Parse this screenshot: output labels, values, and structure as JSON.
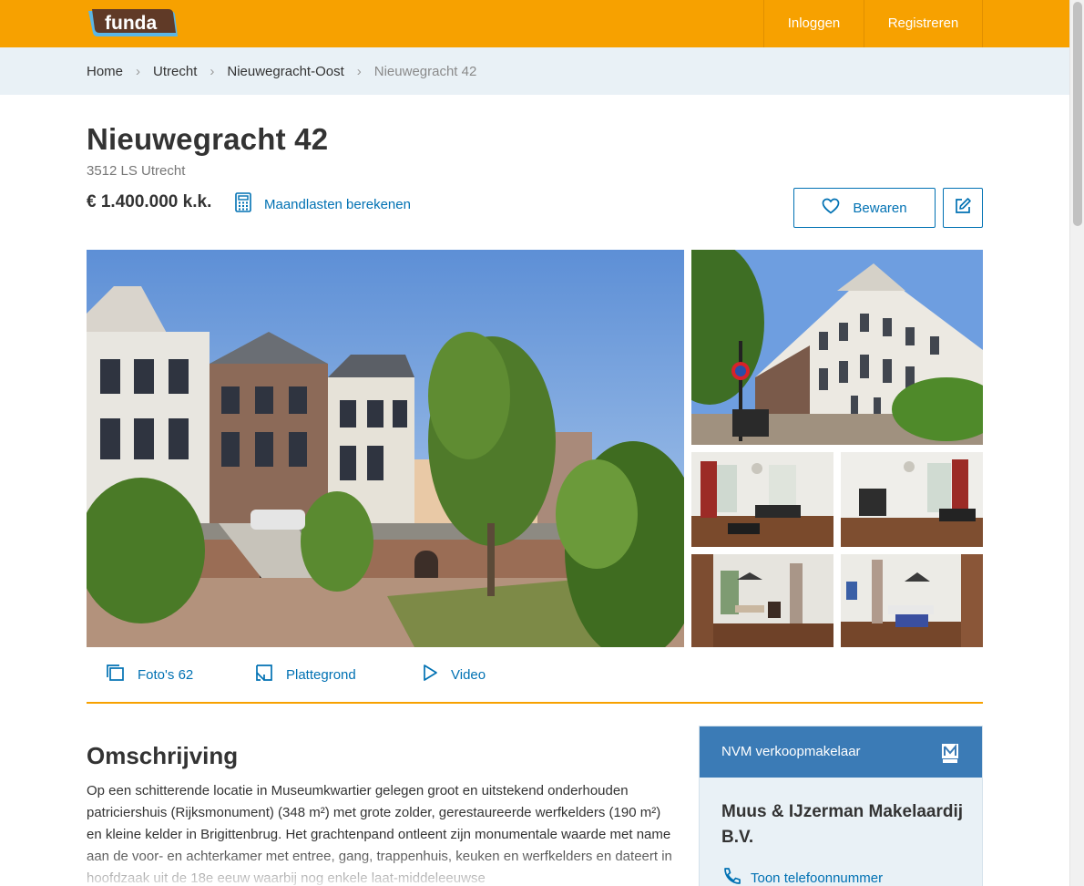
{
  "header": {
    "logo_text": "funda",
    "nav": {
      "login": "Inloggen",
      "register": "Registreren"
    }
  },
  "breadcrumb": {
    "items": [
      "Home",
      "Utrecht",
      "Nieuwegracht-Oost"
    ],
    "current": "Nieuwegracht 42",
    "separator": "›"
  },
  "listing": {
    "title": "Nieuwegracht 42",
    "postal": "3512 LS Utrecht",
    "price": "€ 1.400.000 k.k.",
    "calc_label": "Maandlasten berekenen",
    "save_label": "Bewaren"
  },
  "media": {
    "photos_label": "Foto's",
    "photos_count": "62",
    "floorplan_label": "Plattegrond",
    "video_label": "Video"
  },
  "description": {
    "title": "Omschrijving",
    "text": "Op een schitterende locatie in Museumkwartier gelegen groot en uitstekend onderhouden patriciershuis (Rijksmonument) (348 m²) met grote zolder, gerestaureerde werfkelders (190 m²) en kleine kelder in Brigittenbrug. Het grachtenpand ontleent zijn monumentale waarde met name aan de voor- en achterkamer met entree, gang, trappenhuis, keuken en werfkelders en dateert in hoofdzaak uit de 18e eeuw waarbij nog enkele laat-middeleeuwse"
  },
  "agent": {
    "header_label": "NVM verkoopmakelaar",
    "name": "Muus & IJzerman Makelaardij B.V.",
    "phone_label": "Toon telefoonnummer"
  },
  "colors": {
    "brand_orange": "#f7a100",
    "link_blue": "#0071b3",
    "breadcrumb_bg": "#e9f1f6",
    "agent_header": "#3b7bb6"
  }
}
